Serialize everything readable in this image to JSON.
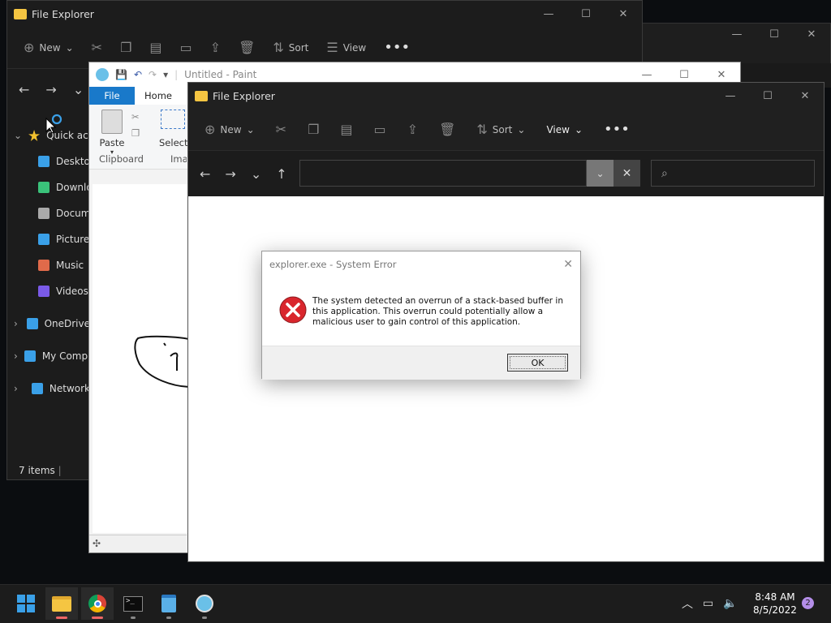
{
  "back_explorer": {
    "title": "File Explorer",
    "toolbar": {
      "new": "New",
      "sort": "Sort",
      "view": "View"
    },
    "nav": [
      {
        "label": "Quick access",
        "icon": "star-icon",
        "color": "#f2c12e"
      },
      {
        "label": "Desktop",
        "icon": "desktop-icon",
        "color": "#3aa0e8"
      },
      {
        "label": "Downloads",
        "icon": "download-icon",
        "color": "#3ac27a"
      },
      {
        "label": "Documents",
        "icon": "document-icon",
        "color": "#aaaaaa"
      },
      {
        "label": "Pictures",
        "icon": "pictures-icon",
        "color": "#3aa0e8"
      },
      {
        "label": "Music",
        "icon": "music-icon",
        "color": "#e06a4a"
      },
      {
        "label": "Videos",
        "icon": "videos-icon",
        "color": "#7a5ae8"
      },
      {
        "label": "OneDrive",
        "icon": "cloud-icon",
        "color": "#3aa0e8"
      },
      {
        "label": "My Computer",
        "icon": "computer-icon",
        "color": "#3aa0e8"
      },
      {
        "label": "Network",
        "icon": "network-icon",
        "color": "#3aa0e8"
      }
    ],
    "status": "7 items"
  },
  "paint": {
    "title": "Untitled - Paint",
    "tabs": {
      "file": "File",
      "home": "Home"
    },
    "ribbon": {
      "paste": "Paste",
      "select": "Select",
      "clipboard_group": "Clipboard",
      "image_group": "Image"
    }
  },
  "front_explorer": {
    "title": "File Explorer",
    "toolbar": {
      "new": "New",
      "sort": "Sort",
      "view": "View"
    },
    "address": "",
    "search_placeholder": ""
  },
  "dialog": {
    "title": "explorer.exe - System Error",
    "message": "The system detected an overrun of a stack-based buffer in this application. This overrun could potentially allow a malicious user to gain control of this application.",
    "ok": "OK"
  },
  "taskbar": {
    "apps": [
      "start-icon",
      "file-explorer-icon",
      "chrome-icon",
      "terminal-icon",
      "notepad-icon",
      "paint-icon"
    ],
    "time": "8:48 AM",
    "date": "8/5/2022",
    "notifications": "2"
  },
  "colors": {
    "accent": "#0067c0",
    "error": "#d9262d"
  }
}
